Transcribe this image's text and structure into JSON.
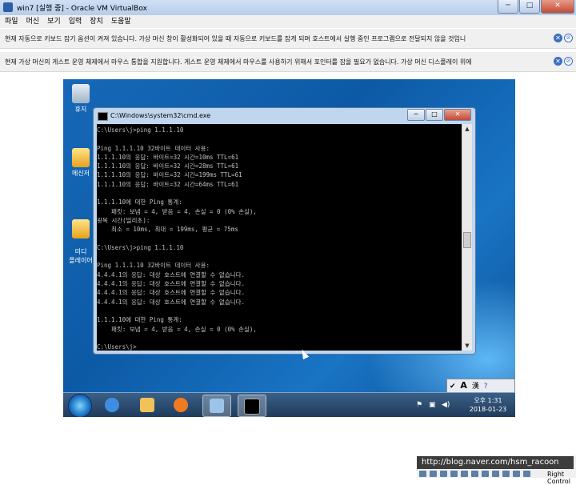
{
  "window": {
    "title": "win7 [실행 중] - Oracle VM VirtualBox",
    "buttons": [
      "─",
      "□",
      "✕"
    ]
  },
  "menu": [
    "파일",
    "머신",
    "보기",
    "입력",
    "장치",
    "도움말"
  ],
  "notifications": [
    "현재 자동으로 키보드 잡기 옵션이 켜져 있습니다. 가상 머신 창이 활성화되어 있을 때 자동으로 키보드를 잡게 되며 호스트에서 실행 중인 프로그램으로 전달되지 않을 것입니",
    "현재 가상 머신의 게스트 운영 체제에서 마우스 통합을 지원합니다. 게스트 운영 체제에서 마우스를 사용하기 위해서 포인터를 잡을 필요가 없습니다. 가상 머신 디스플레이 위에"
  ],
  "desktop": {
    "icons": [
      "휴지",
      "메신저",
      "미디\n플레이어"
    ]
  },
  "cmd": {
    "title": "C:\\Windows\\system32\\cmd.exe",
    "lines": [
      "C:\\Users\\j>ping 1.1.1.10",
      "",
      "Ping 1.1.1.10 32바이트 데이터 사용:",
      "1.1.1.10의 응답: 바이트=32 시간=10ms TTL=61",
      "1.1.1.10의 응답: 바이트=32 시간=28ms TTL=61",
      "1.1.1.10의 응답: 바이트=32 시간=199ms TTL=61",
      "1.1.1.10의 응답: 바이트=32 시간=64ms TTL=61",
      "",
      "1.1.1.10에 대한 Ping 통계:",
      "    패킷: 보냄 = 4, 받음 = 4, 손실 = 0 (0% 손실),",
      "왕복 시간(밀리초):",
      "    최소 = 10ms, 최대 = 199ms, 평균 = 75ms",
      "",
      "C:\\Users\\j>ping 1.1.1.10",
      "",
      "Ping 1.1.1.10 32바이트 데이터 사용:",
      "4.4.4.1의 응답: 대상 호스트에 연결할 수 없습니다.",
      "4.4.4.1의 응답: 대상 호스트에 연결할 수 없습니다.",
      "4.4.4.1의 응답: 대상 호스트에 연결할 수 없습니다.",
      "4.4.4.1의 응답: 대상 호스트에 연결할 수 없습니다.",
      "",
      "1.1.1.10에 대한 Ping 통계:",
      "    패킷: 보냄 = 4, 받음 = 4, 손실 = 0 (0% 손실),",
      "",
      "C:\\Users\\j>"
    ]
  },
  "langbar": [
    "A",
    "漢"
  ],
  "clock": {
    "time": "오후 1:31",
    "date": "2018-01-23"
  },
  "watermark": "http://blog.naver.com/hsm_racoon",
  "status": {
    "hostkey": "Right Control"
  }
}
